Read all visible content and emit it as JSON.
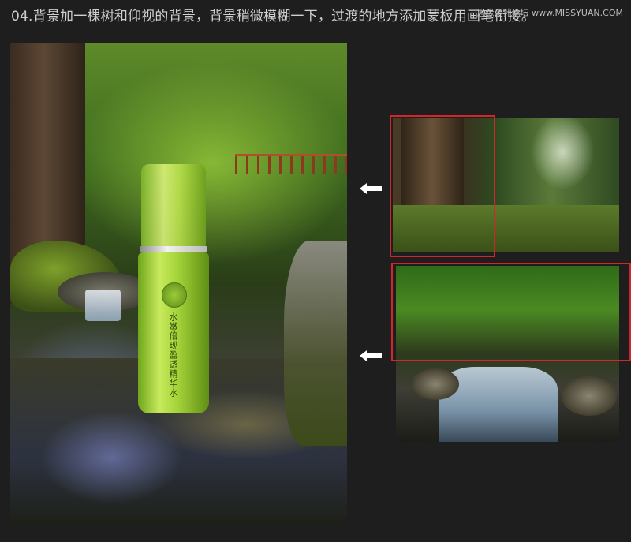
{
  "header": {
    "title": "04.背景加一棵树和仰视的背景，背景稍微模糊一下，过渡的地方添加蒙板用画笔衔接。",
    "watermark": "思缘设计论坛 www.MISSYUAN.COM"
  },
  "product": {
    "bottle_text": "水嫩倍现盈透精华水"
  },
  "colors": {
    "background": "#1e1e1e",
    "highlight_frame": "#d4252a",
    "arrow": "#ffffff"
  },
  "icons": [
    "arrow-left-icon",
    "arrow-left-icon"
  ]
}
